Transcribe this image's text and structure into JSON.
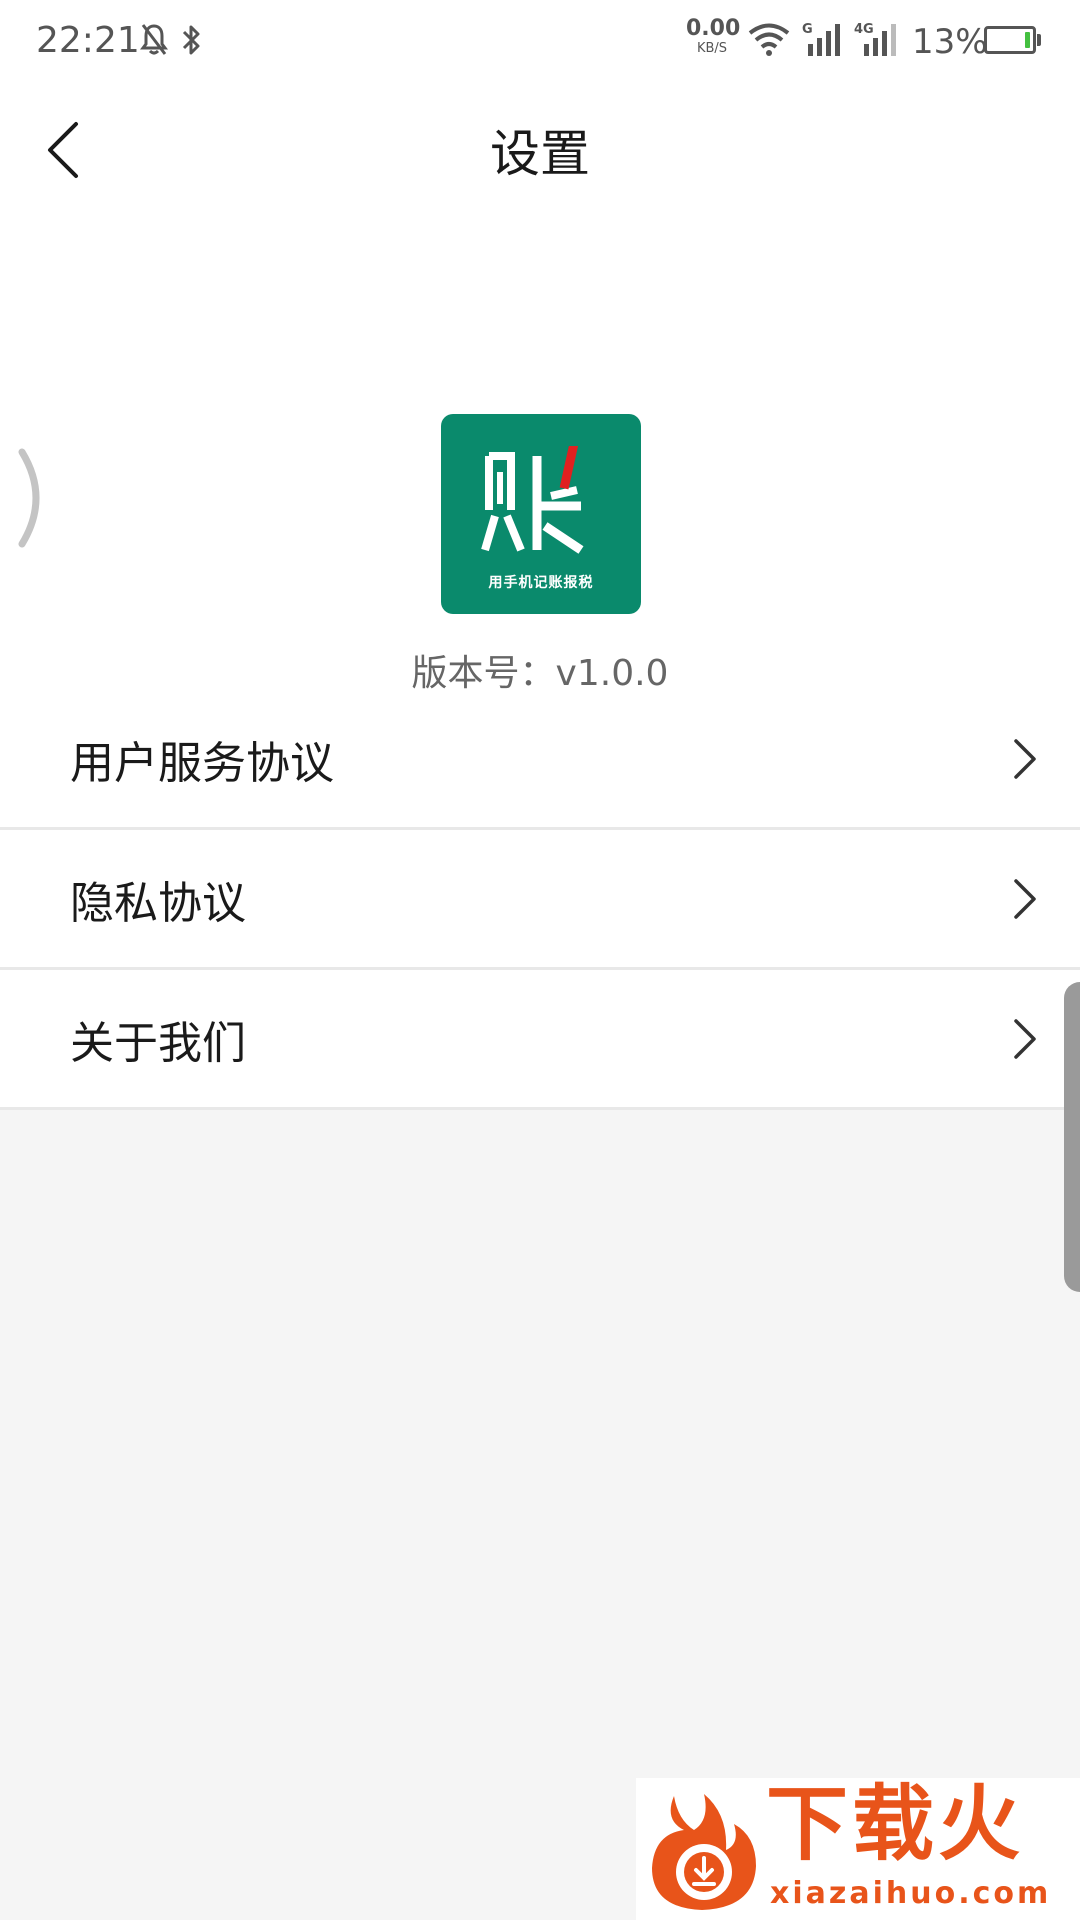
{
  "status_bar": {
    "time": "22:21",
    "speed_value": "0.00",
    "speed_unit": "KB/S",
    "network_1": "G",
    "network_2": "4G",
    "battery_percent": "13%",
    "battery_level": 0.13,
    "icons": [
      "mute-bell-icon",
      "bluetooth-icon",
      "wifi-icon",
      "signal-icon",
      "signal-icon",
      "battery-icon"
    ]
  },
  "header": {
    "title": "设置",
    "back_icon": "back-arrow-icon"
  },
  "app": {
    "logo_tagline": "用手机记账报税",
    "logo_glyph": "账",
    "brand_color": "#0a8a6c",
    "accent_color": "#e02020",
    "version": "版本号：v1.0.0"
  },
  "menu": {
    "items": [
      {
        "label": "用户服务协议",
        "icon": "chevron-right-icon"
      },
      {
        "label": "隐私协议",
        "icon": "chevron-right-icon"
      },
      {
        "label": "关于我们",
        "icon": "chevron-right-icon"
      }
    ]
  },
  "watermark": {
    "name": "下载火",
    "url": "xiazaihuo.com",
    "color": "#e8541a"
  }
}
